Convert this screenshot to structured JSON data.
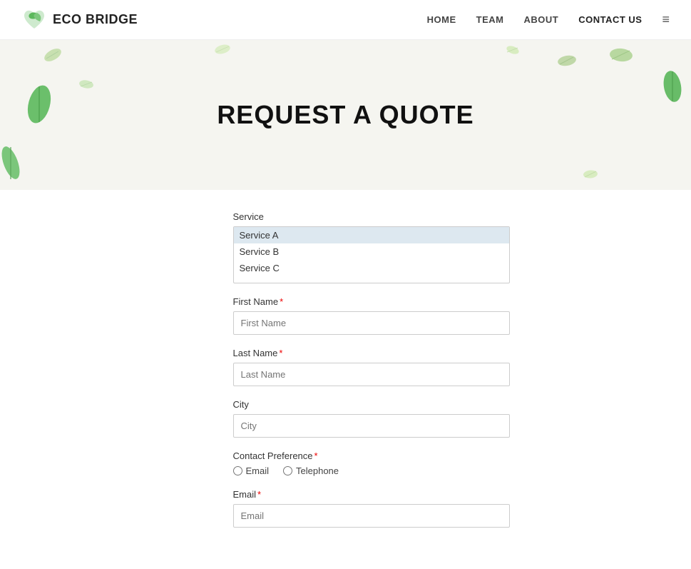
{
  "navbar": {
    "logo_text": "ECO BRIDGE",
    "links": [
      {
        "label": "HOME",
        "name": "nav-home"
      },
      {
        "label": "TEAM",
        "name": "nav-team"
      },
      {
        "label": "ABOUT",
        "name": "nav-about"
      },
      {
        "label": "CONTACT US",
        "name": "nav-contact",
        "active": true
      }
    ]
  },
  "hero": {
    "title": "REQUEST A QUOTE"
  },
  "form": {
    "service_label": "Service",
    "service_options": [
      "Service A",
      "Service B",
      "Service C"
    ],
    "first_name_label": "First Name",
    "first_name_required": true,
    "first_name_placeholder": "First Name",
    "last_name_label": "Last Name",
    "last_name_required": true,
    "last_name_placeholder": "Last Name",
    "city_label": "City",
    "city_placeholder": "City",
    "contact_pref_label": "Contact Preference",
    "contact_pref_required": true,
    "contact_options": [
      "Email",
      "Telephone"
    ],
    "email_label": "Email",
    "email_required": true,
    "email_placeholder": "Email"
  }
}
